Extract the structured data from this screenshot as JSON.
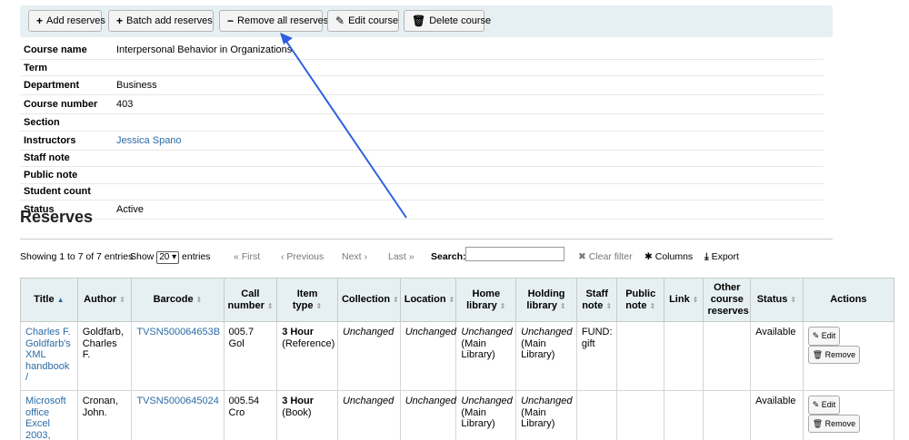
{
  "toolbar": {
    "add_reserves": "Add reserves",
    "batch_add_reserves": "Batch add reserves",
    "remove_all_reserves": "Remove all reserves",
    "edit_course": "Edit course",
    "delete_course": "Delete course"
  },
  "course": {
    "rows": [
      {
        "label": "Course name",
        "value": "Interpersonal Behavior in Organizations"
      },
      {
        "label": "Term",
        "value": ""
      },
      {
        "label": "Department",
        "value": "Business"
      },
      {
        "label": "Course number",
        "value": "403"
      },
      {
        "label": "Section",
        "value": ""
      },
      {
        "label": "Instructors",
        "value": "Jessica Spano"
      },
      {
        "label": "Staff note",
        "value": ""
      },
      {
        "label": "Public note",
        "value": ""
      },
      {
        "label": "Student count",
        "value": ""
      },
      {
        "label": "Status",
        "value": "Active"
      }
    ]
  },
  "reserves": {
    "title": "Reserves",
    "showing": "Showing 1 to 7 of 7 entries",
    "show_label": "Show",
    "page_size": "20",
    "entries_label": "entries",
    "first": "« First",
    "previous": "‹ Previous",
    "next": "Next ›",
    "last": "Last »",
    "search_label": "Search:",
    "clear_filter": "Clear filter",
    "columns": "Columns",
    "export": "Export",
    "headers": [
      "Title",
      "Author",
      "Barcode",
      "Call number",
      "Item type",
      "Collection",
      "Location",
      "Home library",
      "Holding library",
      "Staff note",
      "Public note",
      "Link",
      "Other course reserves",
      "Status",
      "Actions"
    ],
    "rows": [
      {
        "title": "Charles F. Goldfarb's XML handbook /",
        "author": "Goldfarb, Charles F.",
        "barcode": "TVSN500064653B",
        "call_number": "005.7 Gol",
        "item_type_bold": "3 Hour",
        "item_type_rest": "(Reference)",
        "collection": "Unchanged",
        "location": "Unchanged",
        "home_library_it": "Unchanged",
        "home_library_rest": "(Main Library)",
        "holding_library_it": "Unchanged",
        "holding_library_rest": "(Main Library)",
        "staff_note": "FUND: gift",
        "public_note": "",
        "link": "",
        "other": "",
        "status": "Available",
        "edit": "Edit",
        "remove": "Remove"
      },
      {
        "title": "Microsoft office Excel 2003,",
        "author": "Cronan, John.",
        "barcode": "TVSN5000645024",
        "call_number": "005.54 Cro",
        "item_type_bold": "3 Hour",
        "item_type_rest": "(Book)",
        "collection": "Unchanged",
        "location": "Unchanged",
        "home_library_it": "Unchanged",
        "home_library_rest": "(Main Library)",
        "holding_library_it": "Unchanged",
        "holding_library_rest": "(Main Library)",
        "staff_note": "",
        "public_note": "",
        "link": "",
        "other": "",
        "status": "Available",
        "edit": "Edit",
        "remove": "Remove"
      }
    ]
  },
  "colors": {
    "toolbar_bg": "#e6f0f2",
    "link": "#2a6ba6",
    "annotation_arrow": "#2f5fe0"
  }
}
